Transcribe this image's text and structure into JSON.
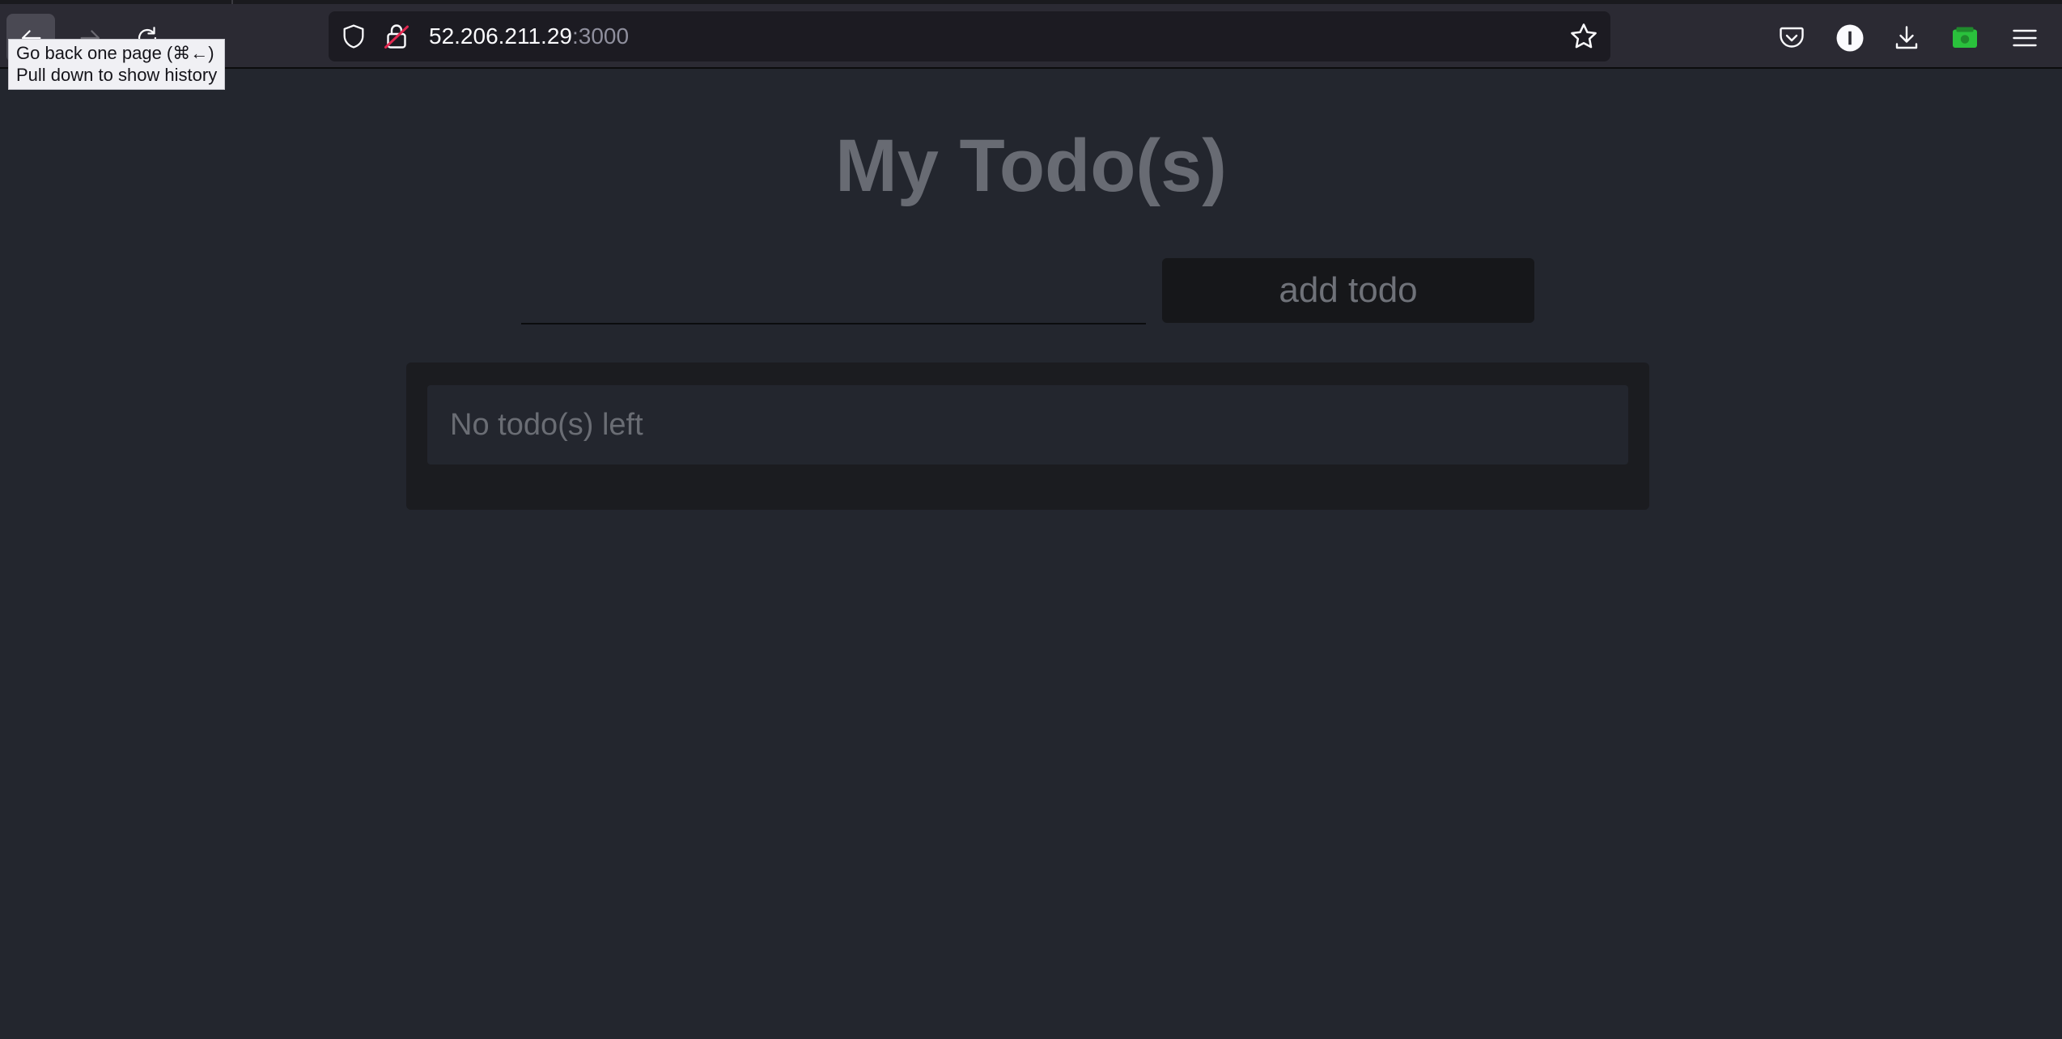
{
  "browser": {
    "url_host": "52.206.211.29",
    "url_port": ":3000",
    "tooltip": {
      "line1": "Go back one page (⌘←)",
      "line2": "Pull down to show history"
    },
    "toolbar_icons": [
      "back-arrow-icon",
      "forward-arrow-icon",
      "reload-icon",
      "shield-icon",
      "insecure-lock-icon",
      "star-icon",
      "pocket-icon",
      "info-icon",
      "download-icon",
      "extension-icon",
      "hamburger-menu-icon"
    ],
    "colors": {
      "toolbar": "#2b2a33",
      "urlbar": "#1c1b22",
      "lock_strike": "#e22850",
      "extension_green": "#2ac13c"
    }
  },
  "app": {
    "title": "My Todo(s)",
    "input": {
      "value": "",
      "placeholder": ""
    },
    "add_button_label": "add todo",
    "empty_message": "No todo(s) left",
    "colors": {
      "background": "#23262e",
      "panel": "#1b1c20",
      "button": "#16171a"
    }
  }
}
